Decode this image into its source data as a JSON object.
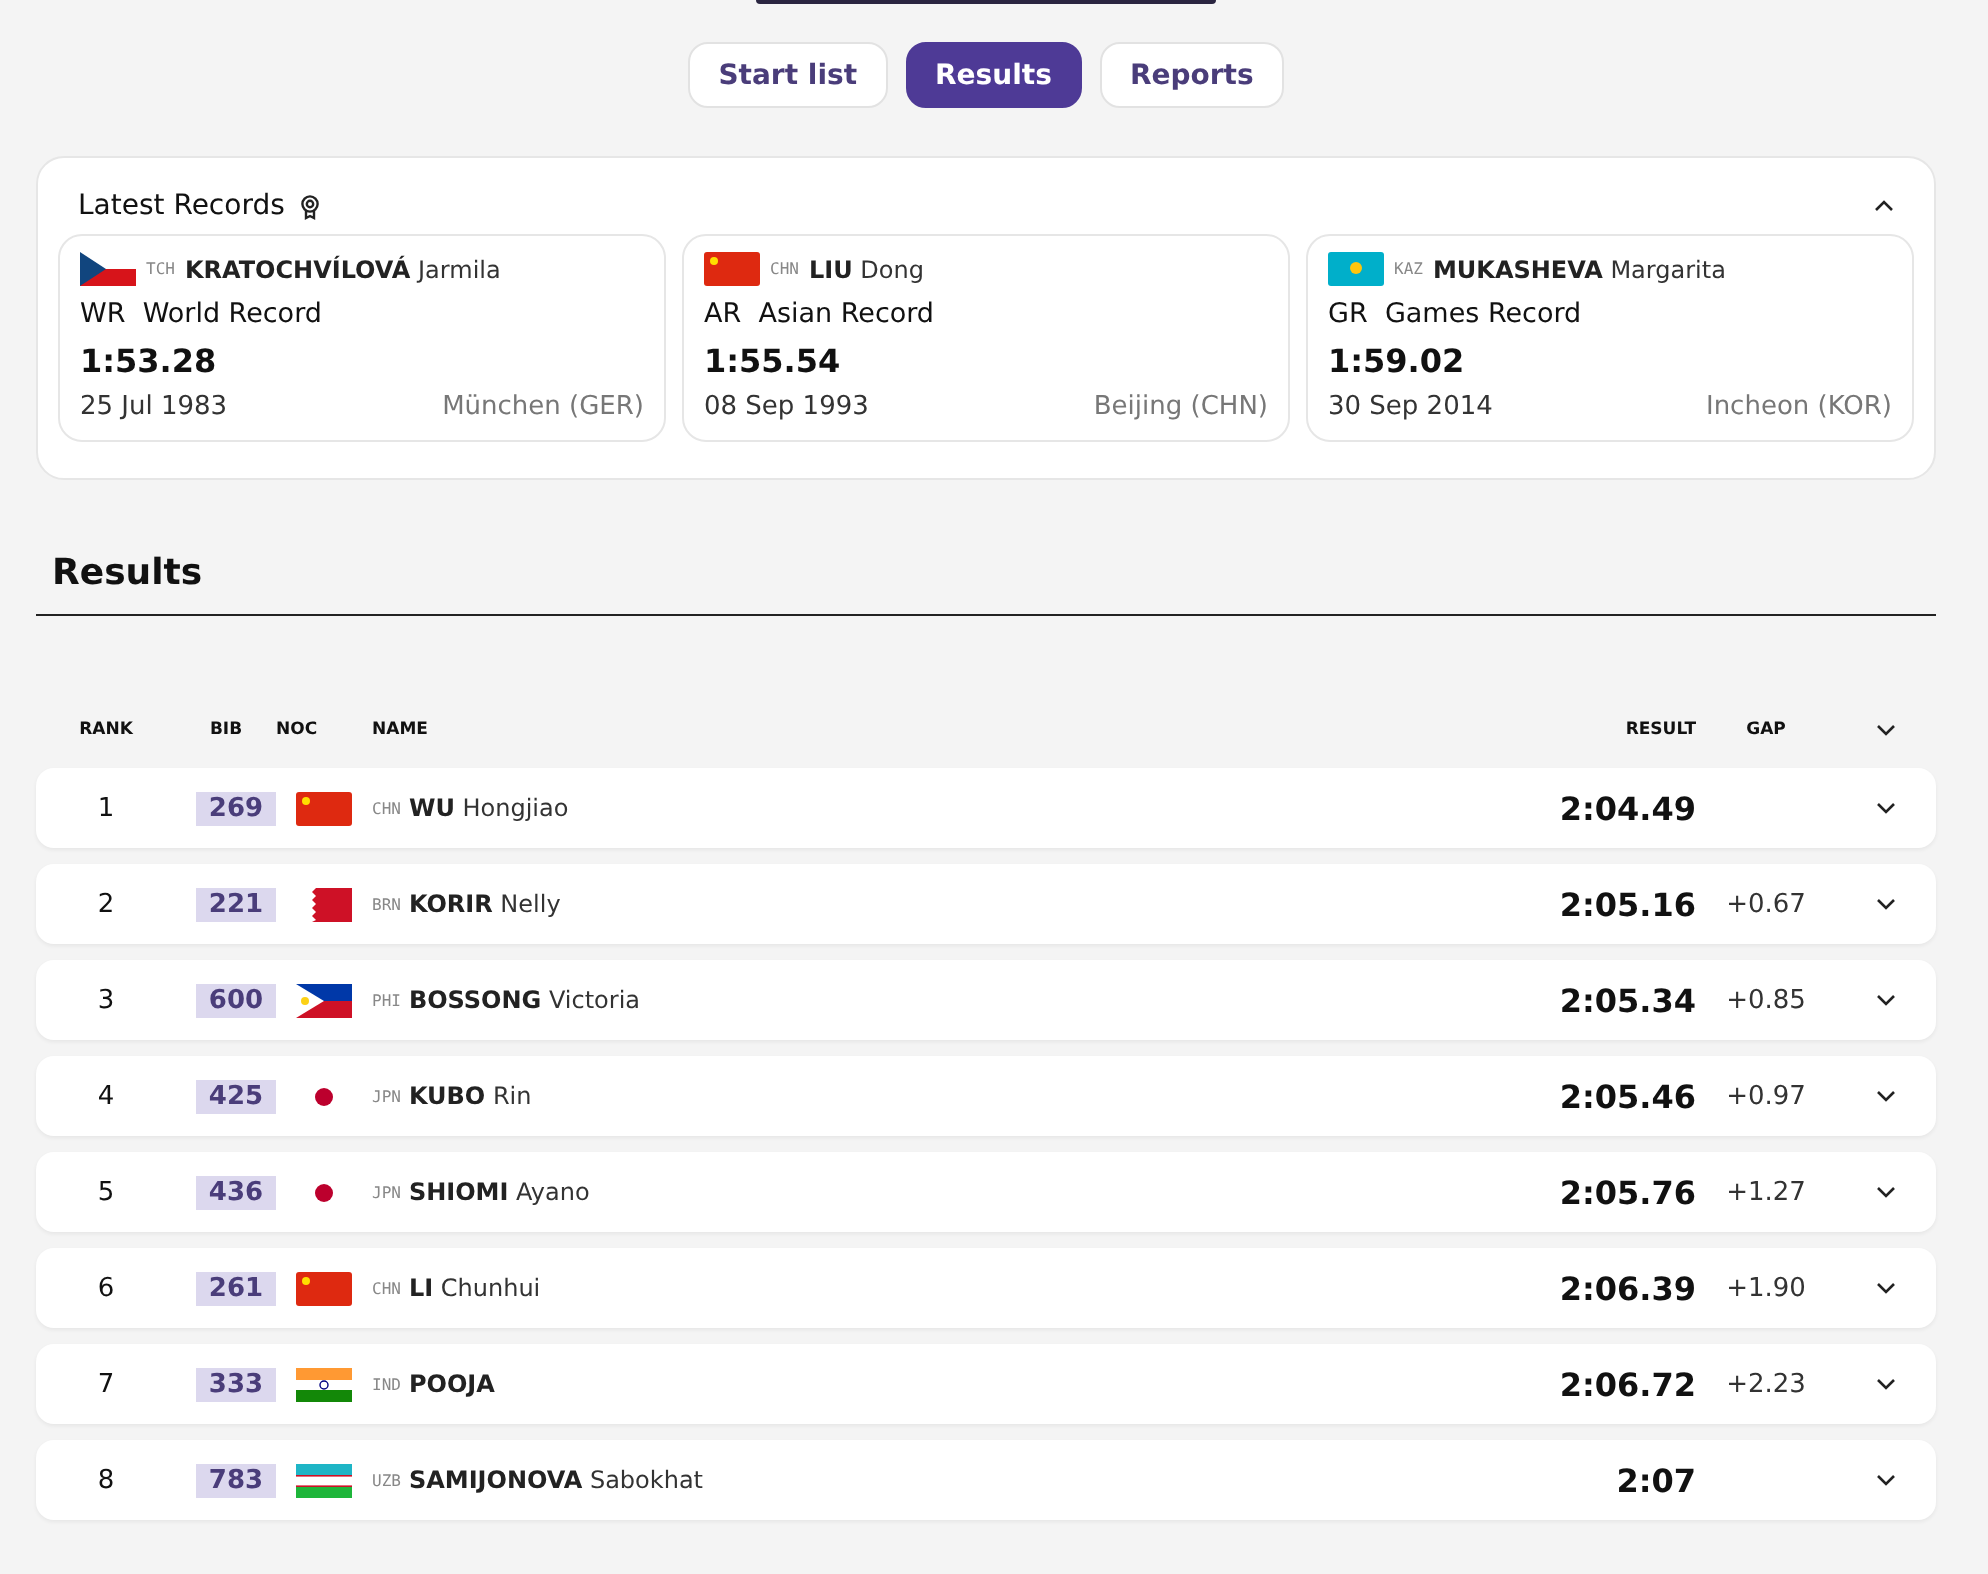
{
  "tabs": [
    {
      "label": "Start list",
      "selected": false
    },
    {
      "label": "Results",
      "selected": true
    },
    {
      "label": "Reports",
      "selected": false
    }
  ],
  "latest_records": {
    "title": "Latest Records",
    "expanded": true,
    "records": [
      {
        "kind": "cze",
        "noc": "TCH",
        "family_name": "KRATOCHVÍLOVÁ",
        "given_name": "Jarmila",
        "code": "WR",
        "type": "World Record",
        "result": "1:53.28",
        "date": "25 Jul 1983",
        "venue": "München (GER)"
      },
      {
        "kind": "chn",
        "noc": "CHN",
        "family_name": "LIU",
        "given_name": "Dong",
        "code": "AR",
        "type": "Asian Record",
        "result": "1:55.54",
        "date": "08 Sep 1993",
        "venue": "Beijing (CHN)"
      },
      {
        "kind": "kaz",
        "noc": "KAZ",
        "family_name": "MUKASHEVA",
        "given_name": "Margarita",
        "code": "GR",
        "type": "Games Record",
        "result": "1:59.02",
        "date": "30 Sep 2014",
        "venue": "Incheon (KOR)"
      }
    ]
  },
  "results": {
    "title": "Results",
    "columns": [
      "RANK",
      "BIB",
      "NOC",
      "NAME",
      "RESULT",
      "GAP"
    ],
    "rows": [
      {
        "rank": "1",
        "bib": "269",
        "kind": "chn",
        "noc": "CHN",
        "family_name": "WU",
        "given_name": "Hongjiao",
        "result": "2:04.49"
      },
      {
        "rank": "2",
        "bib": "221",
        "kind": "brn",
        "noc": "BRN",
        "family_name": "KORIR",
        "given_name": "Nelly",
        "result": "2:05.16",
        "gap": "+0.67"
      },
      {
        "rank": "3",
        "bib": "600",
        "kind": "phi",
        "noc": "PHI",
        "family_name": "BOSSONG",
        "given_name": "Victoria",
        "result": "2:05.34",
        "gap": "+0.85"
      },
      {
        "rank": "4",
        "bib": "425",
        "kind": "jpn",
        "noc": "JPN",
        "family_name": "KUBO",
        "given_name": "Rin",
        "result": "2:05.46",
        "gap": "+0.97"
      },
      {
        "rank": "5",
        "bib": "436",
        "kind": "jpn",
        "noc": "JPN",
        "family_name": "SHIOMI",
        "given_name": "Ayano",
        "result": "2:05.76",
        "gap": "+1.27"
      },
      {
        "rank": "6",
        "bib": "261",
        "kind": "chn",
        "noc": "CHN",
        "family_name": "LI",
        "given_name": "Chunhui",
        "result": "2:06.39",
        "gap": "+1.90"
      },
      {
        "rank": "7",
        "bib": "333",
        "kind": "ind",
        "noc": "IND",
        "family_name": "POOJA",
        "result": "2:06.72",
        "gap": "+2.23"
      },
      {
        "rank": "8",
        "bib": "783",
        "kind": "uzb",
        "noc": "UZB",
        "family_name": "SAMIJONOVA",
        "given_name": "Sabokhat",
        "result": "2:07"
      }
    ]
  }
}
